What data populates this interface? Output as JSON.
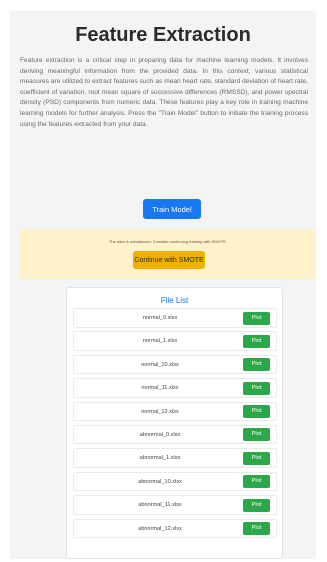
{
  "header": {
    "title": "Feature Extraction"
  },
  "description": "Feature extraction is a critical step in preparing data for machine learning models. It involves deriving meaningful information from the provided data. In this context, various statistical measures are utilized to extract features such as mean heart rate, standard deviation of heart rate, coefficient of variation, root mean square of successive differences (RMSSD), and power spectral density (PSD) components from numeric data. These features play a key role in training machine learning models for further analysis. Press the \"Train Model\" button to initiate the training process using the features extracted from your data.",
  "actions": {
    "train_label": "Train Model"
  },
  "warning": {
    "text": "The data is unbalanced. Consider continuing training with SMOTE.",
    "smote_label": "Continue with SMOTE"
  },
  "file_list": {
    "title": "File List",
    "plot_label": "Plot",
    "files": [
      "normal_0.xlsx",
      "normal_1.xlsx",
      "normal_10.xlsx",
      "normal_11.xlsx",
      "normal_12.xlsx",
      "abnormal_0.xlsx",
      "abnormal_1.xlsx",
      "abnormal_10.xlsx",
      "abnormal_11.xlsx",
      "abnormal_12.xlsx"
    ]
  },
  "colors": {
    "primary": "#1877f2",
    "warning_bg": "#fdf2cc",
    "warning_button": "#f0b000",
    "plot_button": "#2aa84a"
  }
}
